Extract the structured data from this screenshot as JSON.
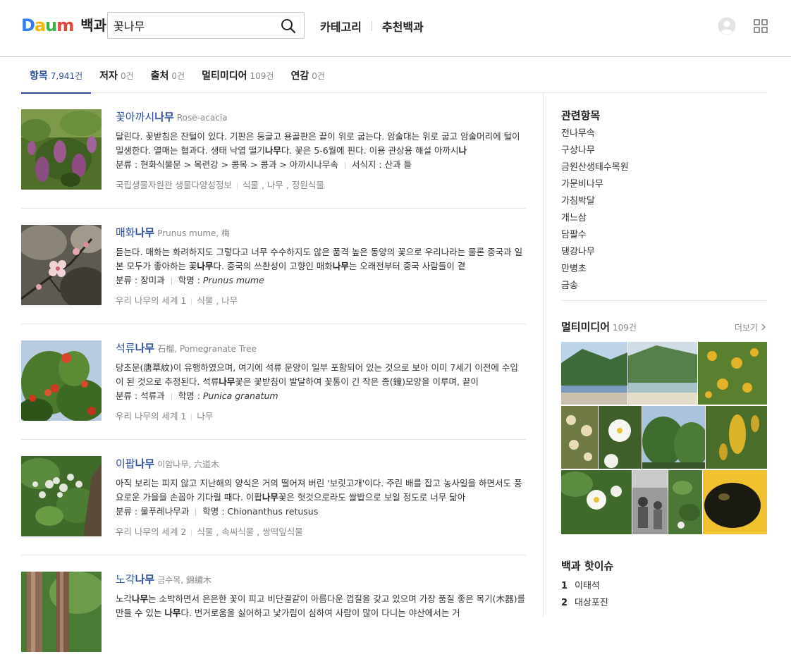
{
  "header": {
    "logo_text": [
      "D",
      "a",
      "u",
      "m"
    ],
    "logo_title": "백과",
    "search_value": "꽃나무",
    "nav": [
      "카테고리",
      "추천백과"
    ]
  },
  "tabs": [
    {
      "label": "항목",
      "count": "7,941건",
      "active": true
    },
    {
      "label": "저자",
      "count": "0건",
      "active": false
    },
    {
      "label": "출처",
      "count": "0건",
      "active": false
    },
    {
      "label": "멀티미디어",
      "count": "109건",
      "active": false
    },
    {
      "label": "연감",
      "count": "0건",
      "active": false
    }
  ],
  "results": [
    {
      "title_pre": "꽃아까시",
      "title_bold": "나무",
      "title_post": "",
      "subtitle": "Rose-acacia",
      "desc_html": "달린다. 꽃받침은 잔털이 있다. 기판은 둥글고 용골판은 끝이 위로 굽는다. 암술대는 위로 굽고 암술머리에 털이 밀생한다. 열매는 협과다. 생태 낙엽 떨기<b>나무</b>다. 꽃은 5-6월에 핀다. 이용 관상용 해설 아까시<b>나</b>",
      "meta": [
        {
          "label": "분류",
          "value": "현화식물문 > 목련강 > 콩목 > 콩과 > 아까시나무속",
          "italic": false
        },
        {
          "label": "서식지",
          "value": "산과 들",
          "italic": false
        }
      ],
      "source": [
        "국립생물자원관 생물다양성정보",
        "식물 , 나무 , 정원식물"
      ]
    },
    {
      "title_pre": "매화",
      "title_bold": "나무",
      "title_post": "",
      "subtitle": "Prunus mume, 梅",
      "desc_html": "듣는다. 매화는 화려하지도 그렇다고 너무 수수하지도 않은 품격 높은 동양의 꽃으로 우리나라는 물론 중국과 일본 모두가 좋아하는 꽃<b>나무</b>다. 중국의 쓰촨성이 고향인 매화<b>나무</b>는 오래전부터 중국 사람들이 곁",
      "meta": [
        {
          "label": "분류",
          "value": "장미과",
          "italic": false
        },
        {
          "label": "학명",
          "value": "Prunus mume",
          "italic": true
        }
      ],
      "source": [
        "우리 나무의 세계 1",
        "식물 , 나무"
      ]
    },
    {
      "title_pre": "석류",
      "title_bold": "나무",
      "title_post": "",
      "subtitle": "石榴, Pomegranate Tree",
      "desc_html": "당초문(唐草紋)이 유행하였으며, 여기에 석류 문양이 일부 포함되어 있는 것으로 보아 이미 7세기 이전에 수입이 된 것으로 추정된다. 석류<b>나무</b>꽃은 꽃받침이 발달하여 꽃통이 긴 작은 종(鐘)모양을 이루며, 끝이",
      "meta": [
        {
          "label": "분류",
          "value": "석류과",
          "italic": false
        },
        {
          "label": "학명",
          "value": "Punica granatum",
          "italic": true
        }
      ],
      "source": [
        "우리 나무의 세계 1",
        "나무"
      ]
    },
    {
      "title_pre": "이팝",
      "title_bold": "나무",
      "title_post": "",
      "subtitle": "이암나무, 六道木",
      "desc_html": "아직 보리는 피지 않고 지난해의 양식은 거의 떨어져 버린 '보릿고개'이다. 주린 배를 잡고 농사일을 하면서도 풍요로운 가을을 손꼽아 기다릴 때다. 이팝<b>나무</b>꽃은 헛것으로라도 쌀밥으로 보일 정도로 너무 닮아",
      "meta": [
        {
          "label": "분류",
          "value": "물푸레나무과",
          "italic": false
        },
        {
          "label": "학명",
          "value": "Chionanthus retusus",
          "italic": false
        }
      ],
      "source": [
        "우리 나무의 세계 2",
        "식물 , 속씨식물 , 쌍떡잎식물"
      ]
    },
    {
      "title_pre": "노각",
      "title_bold": "나무",
      "title_post": "",
      "subtitle": "금수목, 錦繡木",
      "desc_html": "노각<b>나무</b>는 소박하면서 은은한 꽃이 피고 비단결같이 아름다운 껍질을 갖고 있으며 가장 품질 좋은 목기(木器)를 만들 수 있는 <b>나무</b>다. 번거로움을 싫어하고 낯가림이 심하여 사람이 많이 다니는 야산에서는 거",
      "meta": [],
      "source": []
    }
  ],
  "sidebar": {
    "related_title": "관련항목",
    "related": [
      "전나무속",
      "구상나무",
      "금원산생태수목원",
      "가문비나무",
      "가침박달",
      "개느삼",
      "담팔수",
      "댕강나무",
      "만병초",
      "금송"
    ],
    "multimedia_title": "멀티미디어",
    "multimedia_count": "109건",
    "more_label": "더보기",
    "hot_title": "백과 핫이슈",
    "hot": [
      {
        "rank": "1",
        "label": "이태석"
      },
      {
        "rank": "2",
        "label": "대상포진"
      }
    ]
  }
}
